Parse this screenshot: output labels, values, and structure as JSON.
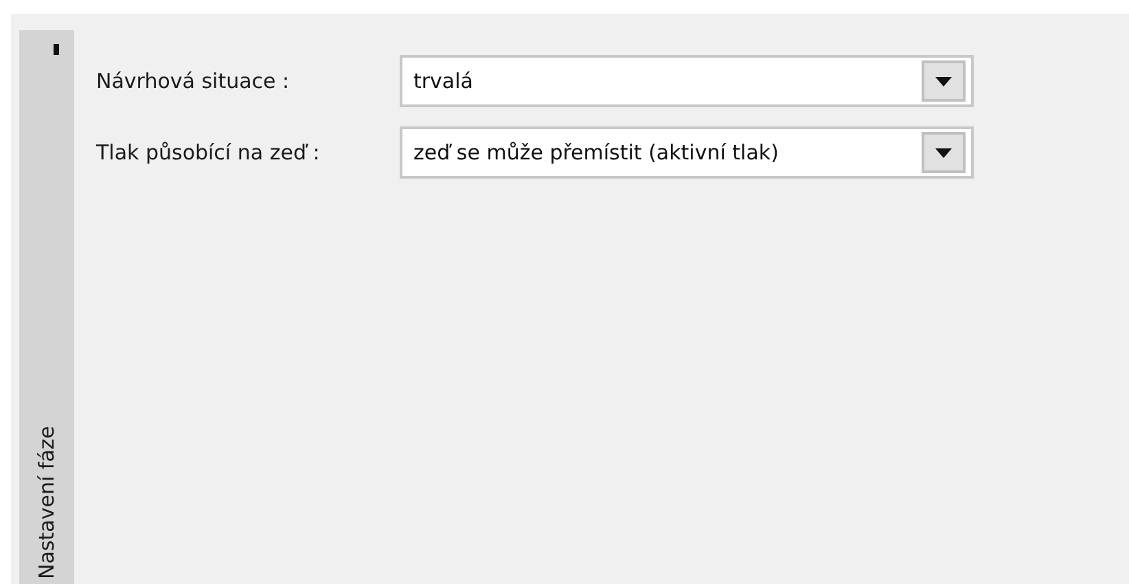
{
  "side_tab": {
    "label": "Nastavení fáze"
  },
  "fields": [
    {
      "label": "Návrhová situace :",
      "value": "trvalá"
    },
    {
      "label": "Tlak působící na zeď :",
      "value": "zeď se může přemístit (aktivní tlak)"
    }
  ]
}
